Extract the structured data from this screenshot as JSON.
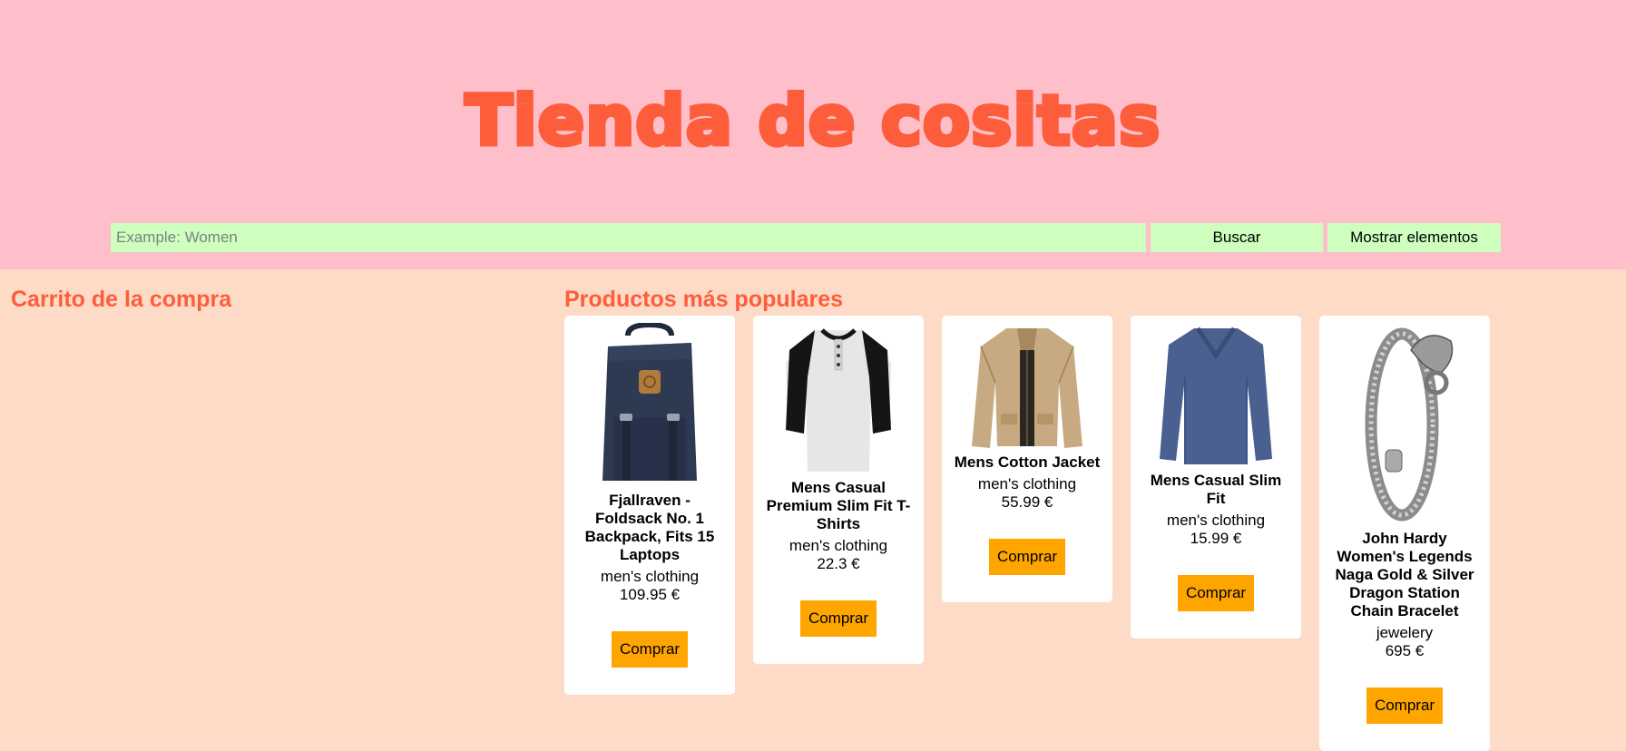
{
  "header": {
    "title": "Tienda de cositas",
    "search_placeholder": "Example: Women",
    "search_value": "",
    "search_button": "Buscar",
    "show_button": "Mostrar elementos"
  },
  "cart": {
    "title": "Carrito de la compra"
  },
  "products": {
    "title": "Productos más populares",
    "buy_label": "Comprar",
    "items": [
      {
        "name": "Fjallraven - Foldsack No. 1 Backpack, Fits 15 Laptops",
        "category": "men's clothing",
        "price": "109.95 €",
        "image": "backpack-icon"
      },
      {
        "name": "Mens Casual Premium Slim Fit T-Shirts",
        "category": "men's clothing",
        "price": "22.3 €",
        "image": "tshirt-icon"
      },
      {
        "name": "Mens Cotton Jacket",
        "category": "men's clothing",
        "price": "55.99 €",
        "image": "jacket-icon"
      },
      {
        "name": "Mens Casual Slim Fit",
        "category": "men's clothing",
        "price": "15.99 €",
        "image": "sweater-icon"
      },
      {
        "name": "John Hardy Women's Legends Naga Gold & Silver Dragon Station Chain Bracelet",
        "category": "jewelery",
        "price": "695 €",
        "image": "bracelet-icon"
      }
    ]
  },
  "colors": {
    "header_bg": "#ffbfca",
    "page_bg": "#fddbc7",
    "accent": "#fe5d3b",
    "search_bg": "#ceffbf",
    "buy_button": "#ffa500"
  }
}
